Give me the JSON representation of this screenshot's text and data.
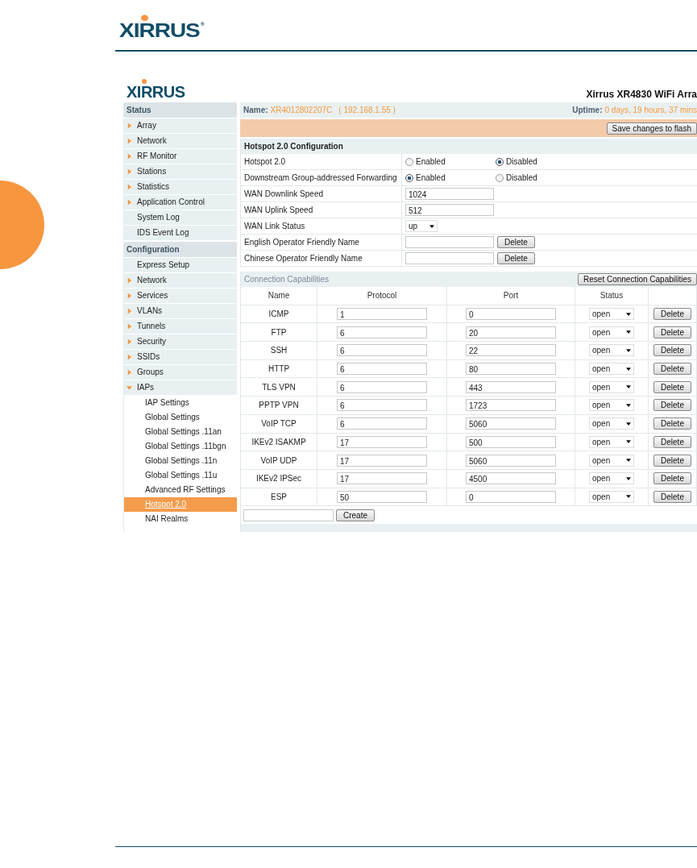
{
  "manual_header": {
    "logo": "XIRRUS",
    "mark": "®"
  },
  "app": {
    "logo": "XIRRUS",
    "title": "Xirrus XR4830 WiFi Arra",
    "sidebar": [
      {
        "title": "Status",
        "items": [
          {
            "label": "Array",
            "kind": "arrow",
            "expanded": false,
            "selected": false
          },
          {
            "label": "Network",
            "kind": "arrow",
            "expanded": false,
            "selected": false
          },
          {
            "label": "RF Monitor",
            "kind": "arrow",
            "expanded": false,
            "selected": false
          },
          {
            "label": "Stations",
            "kind": "arrow",
            "expanded": false,
            "selected": false
          },
          {
            "label": "Statistics",
            "kind": "arrow",
            "expanded": false,
            "selected": false
          },
          {
            "label": "Application Control",
            "kind": "arrow",
            "expanded": false,
            "selected": false
          },
          {
            "label": "System Log",
            "kind": "plain",
            "selected": false
          },
          {
            "label": "IDS Event Log",
            "kind": "plain",
            "selected": false
          }
        ]
      },
      {
        "title": "Configuration",
        "items": [
          {
            "label": "Express Setup",
            "kind": "plain",
            "selected": false
          },
          {
            "label": "Network",
            "kind": "arrow",
            "expanded": false,
            "selected": false
          },
          {
            "label": "Services",
            "kind": "arrow",
            "expanded": false,
            "selected": false
          },
          {
            "label": "VLANs",
            "kind": "arrow",
            "expanded": false,
            "selected": false
          },
          {
            "label": "Tunnels",
            "kind": "arrow",
            "expanded": false,
            "selected": false
          },
          {
            "label": "Security",
            "kind": "arrow",
            "expanded": false,
            "selected": false
          },
          {
            "label": "SSIDs",
            "kind": "arrow",
            "expanded": false,
            "selected": false
          },
          {
            "label": "Groups",
            "kind": "arrow",
            "expanded": false,
            "selected": false
          },
          {
            "label": "IAPs",
            "kind": "arrow",
            "expanded": true,
            "selected": false,
            "children": [
              {
                "label": "IAP Settings",
                "selected": false
              },
              {
                "label": "Global Settings",
                "selected": false
              },
              {
                "label": "Global Settings .11an",
                "selected": false
              },
              {
                "label": "Global Settings .11bgn",
                "selected": false
              },
              {
                "label": "Global Settings .11n",
                "selected": false
              },
              {
                "label": "Global Settings .11u",
                "selected": false
              },
              {
                "label": "Advanced RF Settings",
                "selected": false
              },
              {
                "label": "Hotspot 2.0",
                "selected": true
              },
              {
                "label": "NAI Realms",
                "selected": false
              }
            ]
          }
        ]
      }
    ],
    "info_bar": {
      "name_label": "Name:",
      "name": "XR4012802207C",
      "ip": "( 192.168.1.55 )",
      "uptime_label": "Uptime:",
      "uptime": "0 days, 19 hours, 37 mins"
    },
    "save_button": "Save changes to flash",
    "config": {
      "title": "Hotspot 2.0 Configuration",
      "rows": [
        {
          "kind": "radio",
          "label": "Hotspot 2.0",
          "options": [
            {
              "label": "Enabled",
              "selected": false
            },
            {
              "label": "Disabled",
              "selected": true
            }
          ]
        },
        {
          "kind": "radio",
          "label": "Downstream Group-addressed Forwarding",
          "options": [
            {
              "label": "Enabled",
              "selected": true
            },
            {
              "label": "Disabled",
              "selected": false
            }
          ]
        },
        {
          "kind": "input",
          "label": "WAN Downlink Speed",
          "value": "1024"
        },
        {
          "kind": "input",
          "label": "WAN Uplink Speed",
          "value": "512"
        },
        {
          "kind": "select",
          "label": "WAN Link Status",
          "value": "up"
        },
        {
          "kind": "input_delete",
          "label": "English Operator Friendly Name",
          "button": "Delete"
        },
        {
          "kind": "input_delete",
          "label": "Chinese Operator Friendly Name",
          "button": "Delete"
        }
      ]
    },
    "capabilities": {
      "title": "Connection Capabilities",
      "reset_button": "Reset Connection Capabilities",
      "columns": [
        "Name",
        "Protocol",
        "Port",
        "Status"
      ],
      "rows": [
        {
          "name": "ICMP",
          "protocol": "1",
          "port": "0",
          "status": "open",
          "action": "Delete"
        },
        {
          "name": "FTP",
          "protocol": "6",
          "port": "20",
          "status": "open",
          "action": "Delete"
        },
        {
          "name": "SSH",
          "protocol": "6",
          "port": "22",
          "status": "open",
          "action": "Delete"
        },
        {
          "name": "HTTP",
          "protocol": "6",
          "port": "80",
          "status": "open",
          "action": "Delete"
        },
        {
          "name": "TLS VPN",
          "protocol": "6",
          "port": "443",
          "status": "open",
          "action": "Delete"
        },
        {
          "name": "PPTP VPN",
          "protocol": "6",
          "port": "1723",
          "status": "open",
          "action": "Delete"
        },
        {
          "name": "VoIP TCP",
          "protocol": "6",
          "port": "5060",
          "status": "open",
          "action": "Delete"
        },
        {
          "name": "IKEv2 ISAKMP",
          "protocol": "17",
          "port": "500",
          "status": "open",
          "action": "Delete"
        },
        {
          "name": "VoIP UDP",
          "protocol": "17",
          "port": "5060",
          "status": "open",
          "action": "Delete"
        },
        {
          "name": "IKEv2 IPSec",
          "protocol": "17",
          "port": "4500",
          "status": "open",
          "action": "Delete"
        },
        {
          "name": "ESP",
          "protocol": "50",
          "port": "0",
          "status": "open",
          "action": "Delete"
        }
      ],
      "create_button": "Create"
    }
  }
}
